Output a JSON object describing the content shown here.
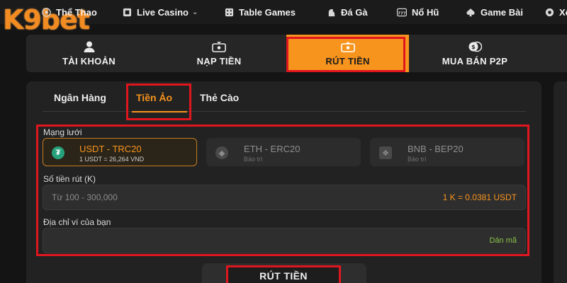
{
  "brand": {
    "logo_text": "K9bet",
    "accent_color": "#f7941d",
    "highlight_color": "#e0161f"
  },
  "topnav": {
    "items": [
      {
        "label": "Thể Thao",
        "icon": "soccer-ball-icon"
      },
      {
        "label": "Live Casino",
        "icon": "casino-chip-icon",
        "has_dropdown": true
      },
      {
        "label": "Table Games",
        "icon": "dice-icon"
      },
      {
        "label": "Đá Gà",
        "icon": "rooster-icon"
      },
      {
        "label": "Nổ Hũ",
        "icon": "slot-777-icon"
      },
      {
        "label": "Game Bài",
        "icon": "spade-icon"
      },
      {
        "label": "Xổ",
        "icon": "lottery-icon"
      }
    ]
  },
  "account_tabs": {
    "items": [
      {
        "label": "TÀI KHOẢN",
        "icon": "user-icon"
      },
      {
        "label": "NẠP TIỀN",
        "icon": "wallet-in-icon"
      },
      {
        "label": "RÚT TIỀN",
        "icon": "wallet-out-icon",
        "active": true
      },
      {
        "label": "MUA BÁN P2P",
        "icon": "coins-icon"
      }
    ]
  },
  "withdraw": {
    "method_tabs": [
      {
        "label": "Ngân Hàng"
      },
      {
        "label": "Tiền Ảo",
        "active": true
      },
      {
        "label": "Thẻ Cào"
      }
    ],
    "network_label": "Mạng lưới",
    "networks": [
      {
        "name": "USDT - TRC20",
        "sub": "1 USDT = 26,264 VND",
        "icon": "tether-icon",
        "active": true
      },
      {
        "name": "ETH - ERC20",
        "sub": "Bảo trì",
        "icon": "ethereum-icon",
        "active": false
      },
      {
        "name": "BNB - BEP20",
        "sub": "Bảo trì",
        "icon": "bnb-icon",
        "active": false
      }
    ],
    "amount_label": "Số tiền rút (K)",
    "amount_placeholder": "Từ 100 - 300,000",
    "rate_text": "1 K = 0.0381 USDT",
    "wallet_label": "Địa chỉ ví của bạn",
    "paste_label": "Dán mã",
    "submit_label": "RÚT TIỀN"
  }
}
